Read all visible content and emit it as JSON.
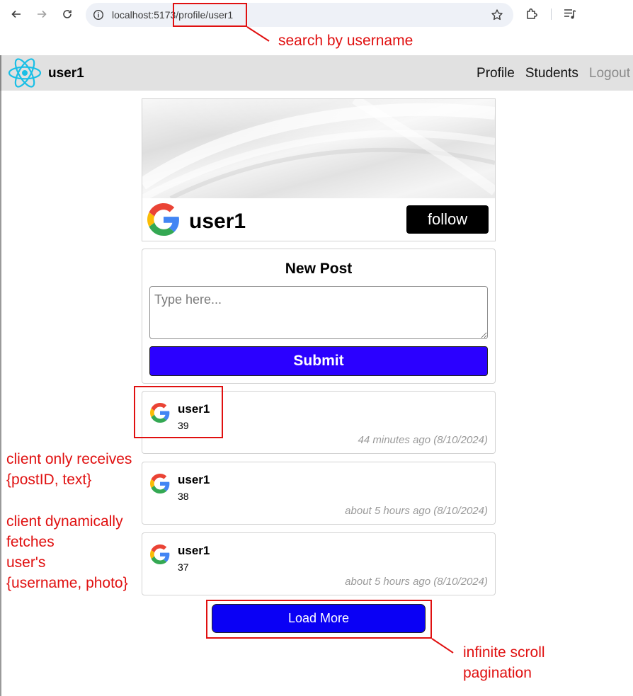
{
  "browser": {
    "url": "localhost:5173/profile/user1"
  },
  "navbar": {
    "username": "user1",
    "links": [
      "Profile",
      "Students",
      "Logout"
    ]
  },
  "profile": {
    "name": "user1",
    "follow_label": "follow"
  },
  "new_post": {
    "title": "New Post",
    "placeholder": "Type here...",
    "submit_label": "Submit"
  },
  "posts": [
    {
      "user": "user1",
      "text": "39",
      "time": "44 minutes ago (8/10/2024)"
    },
    {
      "user": "user1",
      "text": "38",
      "time": "about 5 hours ago (8/10/2024)"
    },
    {
      "user": "user1",
      "text": "37",
      "time": "about 5 hours ago (8/10/2024)"
    }
  ],
  "load_more_label": "Load More",
  "annotations": {
    "search": "search by username",
    "client_receives_1": "client only receives",
    "client_receives_2": "{postID, text}",
    "client_fetches_1": "client dynamically",
    "client_fetches_2": "fetches",
    "client_fetches_3": "user's",
    "client_fetches_4": "{username, photo}",
    "scroll_1": "infinite scroll",
    "scroll_2": "pagination"
  },
  "colors": {
    "submit": "#2b00ff",
    "load_more": "#0a00f5",
    "annotation": "#e01010",
    "navbar_bg": "#e1e1e1"
  }
}
